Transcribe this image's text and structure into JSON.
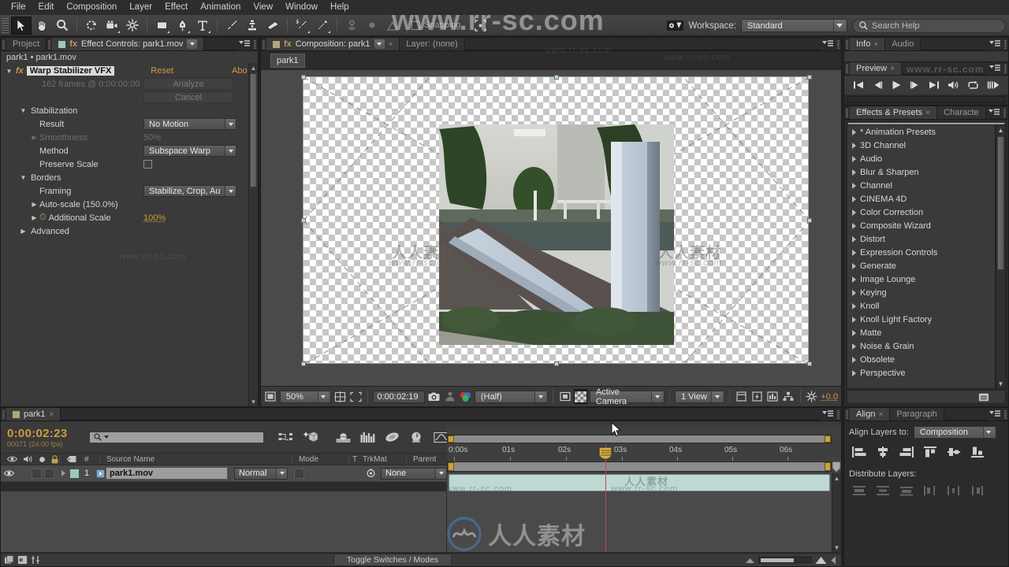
{
  "app": {
    "watermark": "www.rr-sc.com",
    "watermark2": "人人素材"
  },
  "menubar": {
    "items": [
      "File",
      "Edit",
      "Composition",
      "Layer",
      "Effect",
      "Animation",
      "View",
      "Window",
      "Help"
    ]
  },
  "toolbar": {
    "snapping_label": "Snapping",
    "workspace_label": "Workspace:",
    "workspace_value": "Standard",
    "search_help_placeholder": "Search Help",
    "tools": [
      "selection-tool",
      "hand-tool",
      "zoom-tool",
      "rotation-tool",
      "camera-tool",
      "pan-behind-tool",
      "shape-tool",
      "pen-tool",
      "type-tool",
      "brush-tool",
      "clone-stamp-tool",
      "eraser-tool",
      "roto-brush-tool",
      "puppet-pin-tool"
    ]
  },
  "effect_controls": {
    "tab_project": "Project",
    "tab_active": "Effect Controls: park1.mov",
    "breadcrumb": "park1 • park1.mov",
    "effect_name": "Warp Stabilizer VFX",
    "reset_label": "Reset",
    "about_label": "Abo",
    "analysis_status": "162 frames @ 0:00:00:00",
    "analyze_button": "Analyze",
    "cancel_button": "Cancel",
    "groups": [
      {
        "name": "Stabilization",
        "expanded": true
      },
      {
        "name": "Borders",
        "expanded": true
      },
      {
        "name": "Advanced",
        "expanded": false
      }
    ],
    "properties": [
      {
        "label": "Result",
        "value": "No Motion",
        "type": "dropdown",
        "disabled": false
      },
      {
        "label": "Smoothness",
        "value": "50%",
        "type": "text",
        "disabled": true
      },
      {
        "label": "Method",
        "value": "Subspace Warp",
        "type": "dropdown",
        "disabled": false
      },
      {
        "label": "Preserve Scale",
        "value": "",
        "type": "checkbox",
        "disabled": false
      },
      {
        "label": "Framing",
        "value": "Stabilize, Crop, Au",
        "type": "dropdown",
        "disabled": false
      },
      {
        "label": "Auto-scale (150.0%)",
        "value": "",
        "type": "group",
        "disabled": false
      },
      {
        "label": "Additional Scale",
        "value": "100%",
        "type": "value",
        "disabled": false
      }
    ]
  },
  "composition": {
    "tab_active": "Composition: park1",
    "tab_layer": "Layer: (none)",
    "comp_chip": "park1",
    "viewer": {
      "magnification": "50%",
      "current_time": "0:00:02:19",
      "resolution": "(Half)",
      "camera": "Active Camera",
      "views": "1 View",
      "exposure": "+0.0"
    }
  },
  "info": {
    "tab_info": "Info",
    "tab_audio": "Audio"
  },
  "preview": {
    "tab": "Preview",
    "buttons": [
      "first-frame",
      "previous-frame",
      "play",
      "next-frame",
      "last-frame",
      "audio",
      "loop",
      "ram-preview"
    ]
  },
  "effects_presets": {
    "tab": "Effects & Presets",
    "tab2": "Characte",
    "search_placeholder": "",
    "items": [
      "* Animation Presets",
      "3D Channel",
      "Audio",
      "Blur & Sharpen",
      "Channel",
      "CINEMA 4D",
      "Color Correction",
      "Composite Wizard",
      "Distort",
      "Expression Controls",
      "Generate",
      "Image Lounge",
      "Keying",
      "Knoll",
      "Knoll Light Factory",
      "Matte",
      "Noise & Grain",
      "Obsolete",
      "Perspective"
    ]
  },
  "align": {
    "tab": "Align",
    "tab2": "Paragraph",
    "align_layers_label": "Align Layers to:",
    "align_layers_value": "Composition",
    "distribute_label": "Distribute Layers:"
  },
  "timeline": {
    "tab": "park1",
    "current_time": "0:00:02:23",
    "frame_info": "00071 (24.00 fps)",
    "search_placeholder": "",
    "columns": [
      "Source Name",
      "Mode",
      "T",
      "TrkMat",
      "Parent"
    ],
    "column_hash": "#",
    "layers": [
      {
        "index": "1",
        "name": "park1.mov",
        "mode": "Normal",
        "parent": "None",
        "visible": true
      }
    ],
    "ruler_labels": [
      "0:00s",
      "01s",
      "02s",
      "03s",
      "04s",
      "05s",
      "06s"
    ],
    "toggle_switches": "Toggle Switches / Modes"
  }
}
